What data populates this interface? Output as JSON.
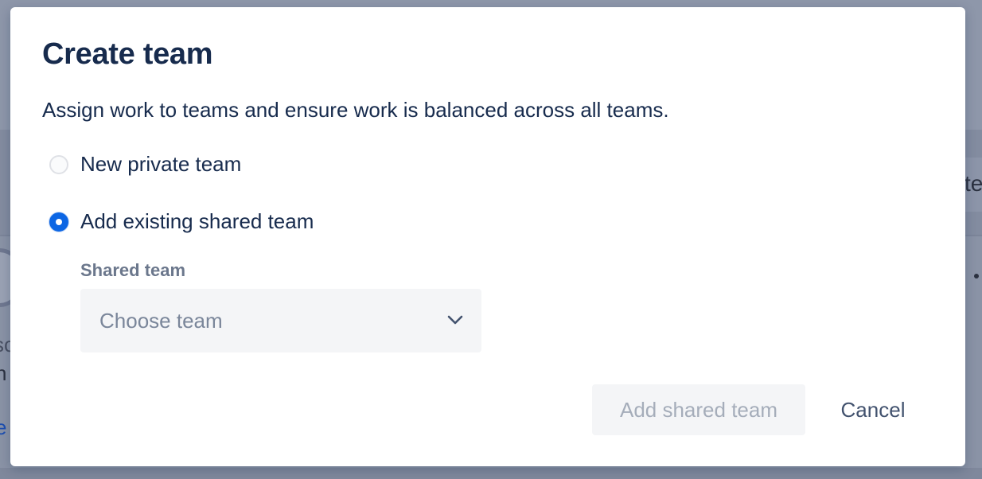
{
  "modal": {
    "title": "Create team",
    "description": "Assign work to teams and ensure work is balanced across all teams."
  },
  "options": [
    {
      "label": "New private team",
      "checked": false
    },
    {
      "label": "Add existing shared team",
      "checked": true
    }
  ],
  "shared_team": {
    "label": "Shared team",
    "placeholder": "Choose team"
  },
  "actions": {
    "primary_label": "Add shared team",
    "primary_disabled": true,
    "cancel_label": "Cancel"
  },
  "colors": {
    "accent": "#0c66e4",
    "text": "#172b4d",
    "muted": "#6b778c"
  },
  "icons": {
    "select": "chevron-down-icon"
  }
}
